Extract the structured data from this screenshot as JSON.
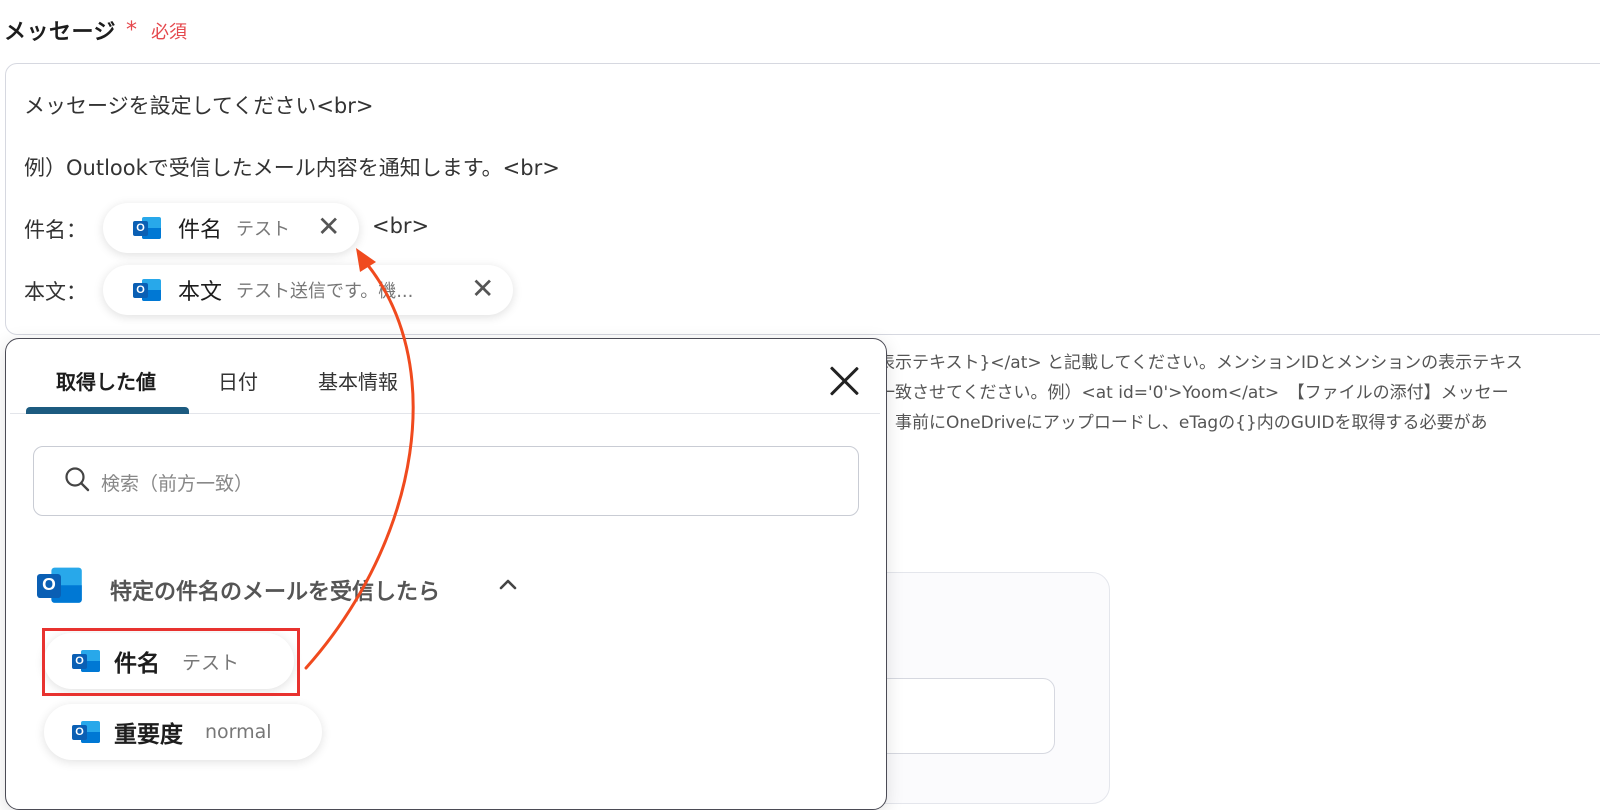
{
  "field": {
    "label": "メッセージ",
    "required_mark": "*",
    "required_text": "必須"
  },
  "message": {
    "line1": "メッセージを設定してください<br>",
    "line2": "例）Outlookで受信したメール内容を通知します。<br>",
    "subject_label": "件名：",
    "body_label": "本文：",
    "br_after_subject": "<br>",
    "subject_pill": {
      "name": "件名",
      "value": "テスト",
      "icon": "outlook-icon"
    },
    "body_pill": {
      "name": "本文",
      "value": "テスト送信です。機...",
      "icon": "outlook-icon"
    }
  },
  "help_text": {
    "line1": "表示テキスト}</at> と記載してください。メンションIDとメンションの表示テキス",
    "line2": "一致させてください。例）<at id='0'>Yoom</at>　【ファイルの添付】メッセー",
    "line3": "。事前にOneDriveにアップロードし、eTagの{}内のGUIDを取得する必要があ"
  },
  "popup": {
    "tabs": [
      {
        "label": "取得した値",
        "active": true
      },
      {
        "label": "日付",
        "active": false
      },
      {
        "label": "基本情報",
        "active": false
      }
    ],
    "search_placeholder": "検索（前方一致）",
    "group": {
      "title": "特定の件名のメールを受信したら",
      "icon": "outlook-icon",
      "expanded": true
    },
    "items": [
      {
        "name": "件名",
        "value": "テスト",
        "highlighted": true
      },
      {
        "name": "重要度",
        "value": "normal",
        "highlighted": false
      }
    ]
  },
  "colors": {
    "required": "#e5484d",
    "tab_underline": "#1c5b80",
    "highlight": "#e8322f",
    "arrow": "#f04a1e"
  }
}
